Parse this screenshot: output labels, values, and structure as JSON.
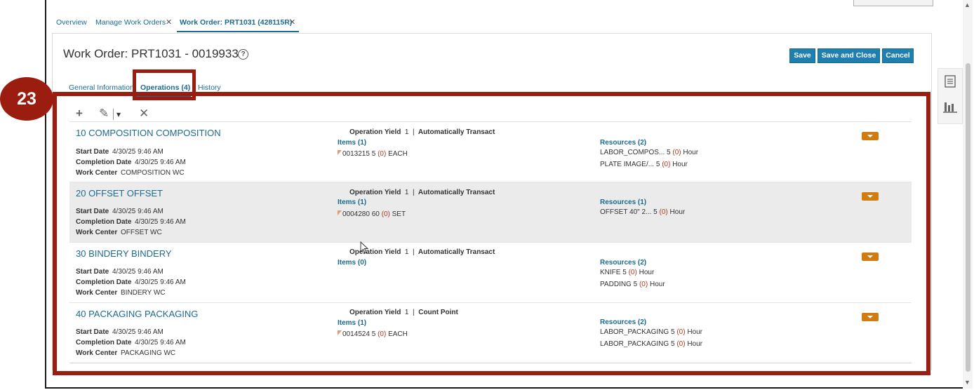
{
  "page_tabs": [
    {
      "label": "Overview",
      "closable": false
    },
    {
      "label": "Manage Work Orders",
      "closable": true
    },
    {
      "label": "Work Order: PRT1031 (428115R)",
      "closable": true,
      "active": true
    }
  ],
  "header": {
    "title": "Work Order: PRT1031 - 0019933",
    "help_glyph": "?",
    "buttons": [
      "Save",
      "Save and Close",
      "Cancel"
    ]
  },
  "sub_tabs": [
    {
      "label": "General Information"
    },
    {
      "label": "Operations (4)",
      "active": true
    },
    {
      "label": "History"
    }
  ],
  "step_badge": "23",
  "highlight_color": "#9b1d0f",
  "accent_color": "#1f7fae",
  "toolbar": {
    "icons": [
      "plus-icon",
      "pencil-icon",
      "chevron-down-icon",
      "close-x-icon"
    ],
    "glyphs": {
      "add": "+",
      "edit": "✎",
      "dropdown": "▾",
      "delete": "✕"
    }
  },
  "labels": {
    "start_date": "Start Date",
    "completion_date": "Completion Date",
    "work_center": "Work Center",
    "operation_yield": "Operation Yield",
    "separator": "|"
  },
  "operations": [
    {
      "title": "10 COMPOSITION COMPOSITION",
      "start_date": "4/30/25 9:46 AM",
      "completion_date": "4/30/25 9:46 AM",
      "work_center": "COMPOSITION WC",
      "yield": "1",
      "yield_type": "Automatically Transact",
      "items_label": "Items (1)",
      "items": [
        {
          "code": "0013215",
          "qty": "5",
          "issued": "(0)",
          "uom": "EACH"
        }
      ],
      "resources_label": "Resources (2)",
      "resources": [
        {
          "name": "LABOR_COMPOS...",
          "qty": "5",
          "used": "(0)",
          "uom": "Hour"
        },
        {
          "name": "PLATE IMAGE/...",
          "qty": "5",
          "used": "(0)",
          "uom": "Hour"
        }
      ]
    },
    {
      "title": "20 OFFSET OFFSET",
      "start_date": "4/30/25 9:46 AM",
      "completion_date": "4/30/25 9:46 AM",
      "work_center": "OFFSET WC",
      "yield": "1",
      "yield_type": "Automatically Transact",
      "items_label": "Items (1)",
      "items": [
        {
          "code": "0004280",
          "qty": "60",
          "issued": "(0)",
          "uom": "SET"
        }
      ],
      "resources_label": "Resources (1)",
      "resources": [
        {
          "name": "OFFSET 40\" 2...",
          "qty": "5",
          "used": "(0)",
          "uom": "Hour"
        }
      ]
    },
    {
      "title": "30 BINDERY BINDERY",
      "start_date": "4/30/25 9:46 AM",
      "completion_date": "4/30/25 9:46 AM",
      "work_center": "BINDERY WC",
      "yield": "1",
      "yield_type": "Automatically Transact",
      "items_label": "Items (0)",
      "items": [],
      "resources_label": "Resources (2)",
      "resources": [
        {
          "name": "KNIFE",
          "qty": "5",
          "used": "(0)",
          "uom": "Hour"
        },
        {
          "name": "PADDING",
          "qty": "5",
          "used": "(0)",
          "uom": "Hour"
        }
      ]
    },
    {
      "title": "40 PACKAGING PACKAGING",
      "start_date": "4/30/25 9:46 AM",
      "completion_date": "4/30/25 9:46 AM",
      "work_center": "PACKAGING WC",
      "yield": "1",
      "yield_type": "Count Point",
      "items_label": "Items (1)",
      "items": [
        {
          "code": "0014524",
          "qty": "5",
          "issued": "(0)",
          "uom": "EACH"
        }
      ],
      "resources_label": "Resources (2)",
      "resources": [
        {
          "name": "LABOR_PACKAGING",
          "qty": "5",
          "used": "(0)",
          "uom": "Hour"
        },
        {
          "name": "LABOR_PACKAGING",
          "qty": "5",
          "used": "(0)",
          "uom": "Hour"
        }
      ]
    }
  ]
}
